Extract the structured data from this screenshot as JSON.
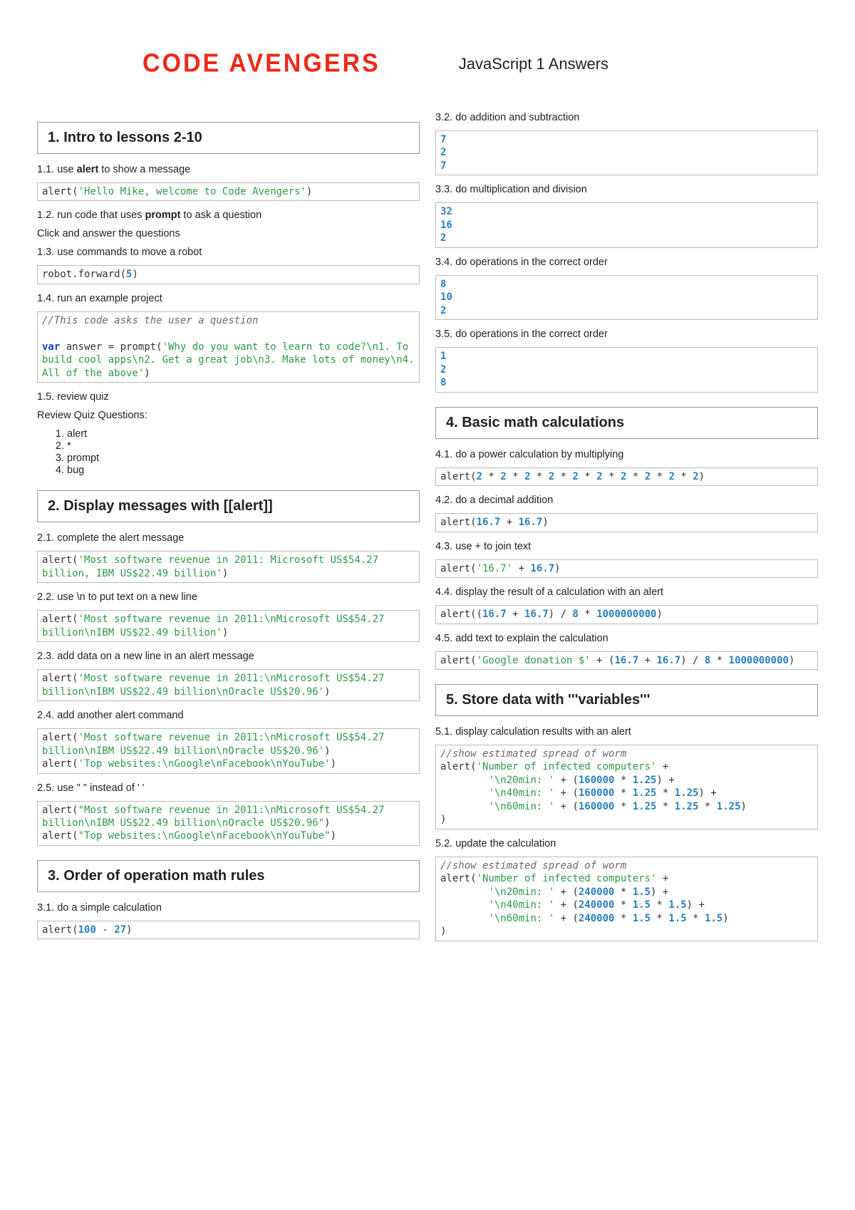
{
  "header": {
    "brand": "CODE AVENGERS",
    "doc_title": "JavaScript 1 Answers"
  },
  "left": {
    "s1": {
      "title": "1. Intro to lessons 2-10",
      "i1": {
        "idx": "1.1.",
        "body_pre": "use ",
        "body_bold": "alert",
        "body_post": " to show a message",
        "code": {
          "fn": "alert",
          "s": "'Hello Mike, welcome to Code Avengers'",
          "close": ")"
        }
      },
      "i2": {
        "idx": "1.2.",
        "body_pre": "run code that uses ",
        "body_bold": "prompt",
        "body_post": " to ask a question",
        "note": "Click and answer the questions"
      },
      "i3": {
        "idx": "1.3.",
        "body": "use commands to move a robot",
        "code": {
          "pre": "robot.forward(",
          "n": "5",
          "post": ")"
        }
      },
      "i4": {
        "idx": "1.4.",
        "body": "run an example project",
        "code": {
          "comment": "//This code asks the user a question",
          "kw": "var",
          "assign": " answer = prompt(",
          "s": "'Why do you want to learn to code?\\n1. To build cool apps\\n2. Get a great job\\n3. Make lots of money\\n4. All of the above'",
          "close": ")"
        }
      },
      "i5": {
        "idx": "1.5.",
        "body": "review quiz",
        "note": "Review Quiz Questions:",
        "quiz": [
          "alert",
          "*",
          "prompt",
          "bug"
        ]
      }
    },
    "s2": {
      "title": "2. Display messages with [[alert]]",
      "i1": {
        "idx": "2.1.",
        "body": "complete the alert message",
        "code": {
          "fn": "alert",
          "s": "'Most software revenue in 2011: Microsoft US$54.27 billion, IBM US$22.49 billion'",
          "close": ")"
        }
      },
      "i2": {
        "idx": "2.2.",
        "body": "use \\n to put text on a new line",
        "code": {
          "fn": "alert",
          "s": "'Most software revenue in 2011:\\nMicrosoft US$54.27 billion\\nIBM US$22.49 billion'",
          "close": ")"
        }
      },
      "i3": {
        "idx": "2.3.",
        "body": "add data on a new line in an alert message",
        "code": {
          "fn": "alert",
          "s": "'Most software revenue in 2011:\\nMicrosoft US$54.27 billion\\nIBM US$22.49 billion\\nOracle US$20.96'",
          "close": ")"
        }
      },
      "i4": {
        "idx": "2.4.",
        "body": "add another alert command",
        "code": {
          "l1": {
            "fn": "alert",
            "s": "'Most software revenue in 2011:\\nMicrosoft US$54.27 billion\\nIBM US$22.49 billion\\nOracle US$20.96'",
            "close": ")"
          },
          "l2": {
            "fn": "alert",
            "s": "'Top websites:\\nGoogle\\nFacebook\\nYouTube'",
            "close": ")"
          }
        }
      },
      "i5": {
        "idx": "2.5.",
        "body": "use \"  \" instead of '  '",
        "code": {
          "l1": {
            "fn": "alert",
            "s": "\"Most software revenue in 2011:\\nMicrosoft US$54.27 billion\\nIBM US$22.49 billion\\nOracle US$20.96\"",
            "close": ")"
          },
          "l2": {
            "fn": "alert",
            "s": "\"Top websites:\\nGoogle\\nFacebook\\nYouTube\"",
            "close": ")"
          }
        }
      }
    },
    "s3": {
      "title": "3. Order of operation math rules",
      "i1": {
        "idx": "3.1.",
        "body": "do a simple calculation",
        "code": {
          "fn": "alert",
          "open": "(",
          "n1": "100",
          "op": " - ",
          "n2": "27",
          "close": ")"
        }
      }
    }
  },
  "right": {
    "r32": {
      "idx": "3.2.",
      "body": "do addition and subtraction",
      "out": "7\n2\n7"
    },
    "r33": {
      "idx": "3.3.",
      "body": "do multiplication and division",
      "out": "32\n16\n2"
    },
    "r34": {
      "idx": "3.4.",
      "body": "do operations in the correct order",
      "out": "8\n10\n2"
    },
    "r35": {
      "idx": "3.5.",
      "body": "do operations in the correct order",
      "out": "1\n2\n8"
    },
    "s4": {
      "title": "4. Basic math calculations",
      "i1": {
        "idx": "4.1.",
        "body": "do a power calculation by multiplying",
        "code": "alert(2 * 2 * 2 * 2 * 2 * 2 * 2 * 2 * 2 * 2)"
      },
      "i2": {
        "idx": "4.2.",
        "body": "do a decimal addition",
        "code": "alert(16.7 + 16.7)"
      },
      "i3": {
        "idx": "4.3.",
        "body": "use + to join text",
        "code": {
          "fn": "alert(",
          "s": "'16.7'",
          "post": " + ",
          "n": "16.7",
          "close": ")"
        }
      },
      "i4": {
        "idx": "4.4.",
        "body": "display the result of a calculation with an alert",
        "code": "alert((16.7 + 16.7) / 8 * 1000000000)"
      },
      "i5": {
        "idx": "4.5.",
        "body": "add text to explain the calculation",
        "code": {
          "fn": "alert(",
          "s": "'Google donation $'",
          "post": " + (",
          "n1": "16.7",
          "op": " + ",
          "n2": "16.7",
          "post2": ") / ",
          "n3": "8",
          "op2": " * ",
          "n4": "1000000000",
          "close": ")"
        }
      }
    },
    "s5": {
      "title": "5. Store data with '''variables'''",
      "i1": {
        "idx": "5.1.",
        "body": "display calculation results with an alert",
        "code": {
          "comment": "//show estimated spread of worm",
          "l0": {
            "fn": "alert(",
            "s": "'Number of infected computers'",
            "plus": " +"
          },
          "l1": {
            "pad": "        ",
            "s": "'\\n20min: '",
            "plus": " + (",
            "n": "160000",
            "op": " * ",
            "m": "1.25",
            "close": ") +"
          },
          "l2": {
            "pad": "        ",
            "s": "'\\n40min: '",
            "plus": " + (",
            "n": "160000",
            "op": " * ",
            "m": "1.25",
            "op2": " * ",
            "m2": "1.25",
            "close": ") +"
          },
          "l3": {
            "pad": "        ",
            "s": "'\\n60min: '",
            "plus": " + (",
            "n": "160000",
            "op": " * ",
            "m": "1.25",
            "op2": " * ",
            "m2": "1.25",
            "op3": " * ",
            "m3": "1.25",
            "close": ")"
          },
          "end": ")"
        }
      },
      "i2": {
        "idx": "5.2.",
        "body": "update the calculation",
        "code": {
          "comment": "//show estimated spread of worm",
          "l0": {
            "fn": "alert(",
            "s": "'Number of infected computers'",
            "plus": " +"
          },
          "l1": {
            "pad": "        ",
            "s": "'\\n20min: '",
            "plus": " + (",
            "n": "240000",
            "op": " * ",
            "m": "1.5",
            "close": ") +"
          },
          "l2": {
            "pad": "        ",
            "s": "'\\n40min: '",
            "plus": " + (",
            "n": "240000",
            "op": " * ",
            "m": "1.5",
            "op2": " * ",
            "m2": "1.5",
            "close": ") +"
          },
          "l3": {
            "pad": "        ",
            "s": "'\\n60min: '",
            "plus": " + (",
            "n": "240000",
            "op": " * ",
            "m": "1.5",
            "op2": " * ",
            "m2": "1.5",
            "op3": " * ",
            "m3": "1.5",
            "close": ")"
          },
          "end": ")"
        }
      }
    }
  }
}
